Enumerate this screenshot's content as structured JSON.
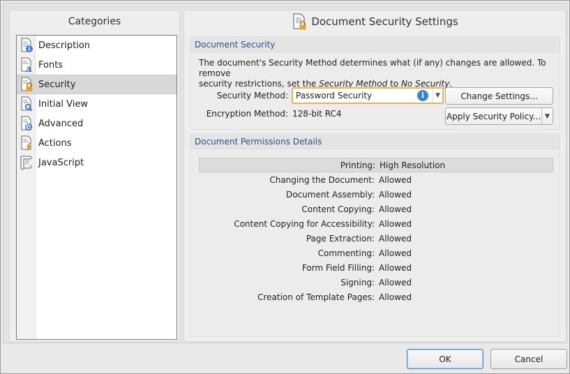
{
  "left": {
    "title": "Categories",
    "items": [
      {
        "label": "Description",
        "icon": "page-info-icon"
      },
      {
        "label": "Fonts",
        "icon": "page-font-icon"
      },
      {
        "label": "Security",
        "icon": "page-lock-icon"
      },
      {
        "label": "Initial View",
        "icon": "page-magnifier-icon"
      },
      {
        "label": "Advanced",
        "icon": "page-gear-icon"
      },
      {
        "label": "Actions",
        "icon": "page-lightning-icon"
      },
      {
        "label": "JavaScript",
        "icon": "scroll-script-icon"
      }
    ],
    "selected_index": 2
  },
  "right": {
    "title": "Document Security Settings",
    "security_group": {
      "header": "Document Security",
      "desc_line1": "The document's Security Method determines what (if any) changes are allowed. To remove",
      "desc_line2_prefix": "security restrictions, set the ",
      "desc_line2_em1": "Security Method",
      "desc_line2_mid": " to ",
      "desc_line2_em2": "No Security",
      "desc_line2_suffix": ".",
      "security_method_label": "Security Method:",
      "security_method_value": "Password Security",
      "encryption_label": "Encryption Method:",
      "encryption_value": "128-bit RC4",
      "change_settings_label": "Change Settings...",
      "apply_policy_label": "Apply Security Policy..."
    },
    "permissions_group": {
      "header": "Document Permissions Details",
      "rows": [
        {
          "key": "Printing:",
          "value": "High Resolution"
        },
        {
          "key": "Changing the Document:",
          "value": "Allowed"
        },
        {
          "key": "Document Assembly:",
          "value": "Allowed"
        },
        {
          "key": "Content Copying:",
          "value": "Allowed"
        },
        {
          "key": "Content Copying for Accessibility:",
          "value": "Allowed"
        },
        {
          "key": "Page Extraction:",
          "value": "Allowed"
        },
        {
          "key": "Commenting:",
          "value": "Allowed"
        },
        {
          "key": "Form Field Filling:",
          "value": "Allowed"
        },
        {
          "key": "Signing:",
          "value": "Allowed"
        },
        {
          "key": "Creation of Template Pages:",
          "value": "Allowed"
        }
      ]
    }
  },
  "footer": {
    "ok_label": "OK",
    "cancel_label": "Cancel"
  },
  "colors": {
    "group_header_text": "#2a4f82",
    "focus_border": "#e6b34a",
    "info_blue": "#3b82d6",
    "lock_orange": "#f0a020"
  }
}
